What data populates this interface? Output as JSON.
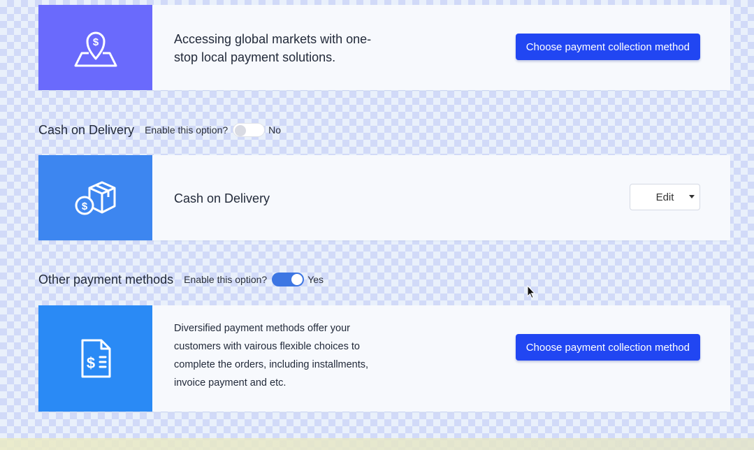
{
  "colors": {
    "primary": "#2146f2",
    "thumb_global": "#6a6afc",
    "thumb_cod": "#3d86f0",
    "thumb_other": "#2a8af5",
    "toggle_on": "#3d76e3"
  },
  "cards": {
    "global": {
      "icon": "location-dollar-pin-icon",
      "description": "Accessing global markets with one-stop local payment solutions.",
      "button_label": "Choose payment collection method"
    },
    "cod": {
      "icon": "dollar-package-icon",
      "title": "Cash on Delivery",
      "edit_label": "Edit"
    },
    "other": {
      "icon": "dollar-invoice-icon",
      "description": "Diversified payment methods offer your customers with vairous flexible choices to complete the orders, including installments, invoice payment and etc.",
      "button_label": "Choose payment collection method"
    }
  },
  "sections": {
    "cod": {
      "title": "Cash on Delivery",
      "enable_label": "Enable this option?",
      "enabled": false,
      "state_label": "No"
    },
    "other": {
      "title": "Other payment methods",
      "enable_label": "Enable this option?",
      "enabled": true,
      "state_label": "Yes"
    }
  }
}
